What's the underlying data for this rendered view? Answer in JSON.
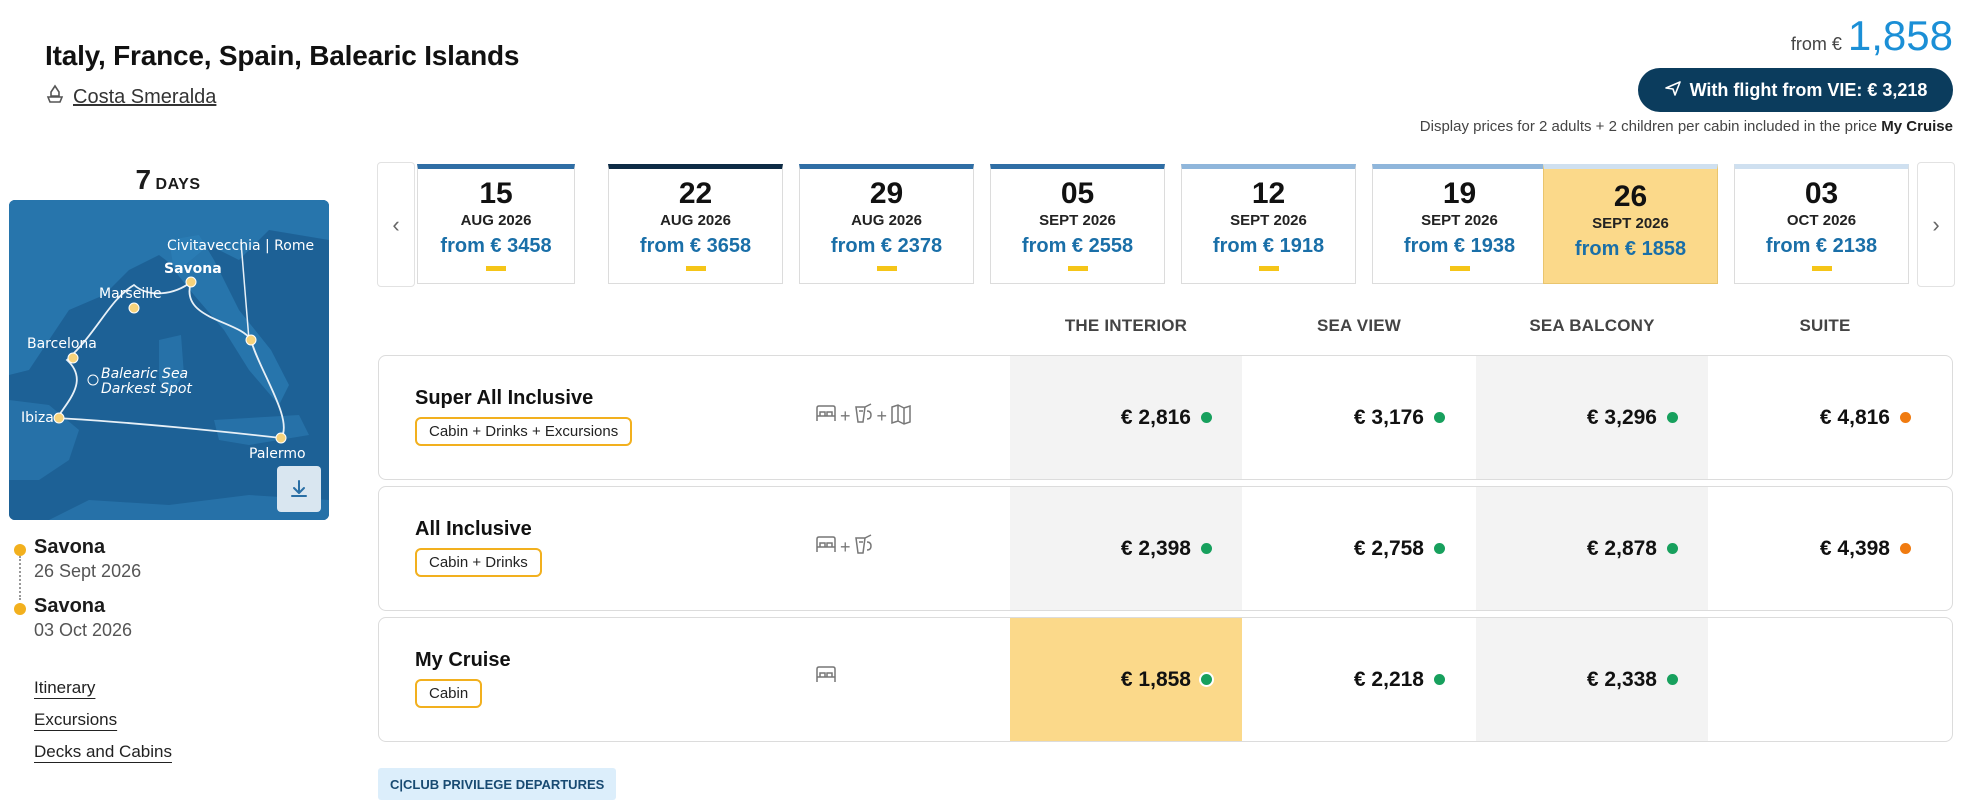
{
  "header": {
    "title": "Italy, France, Spain, Balearic Islands",
    "ship": "Costa Smeralda",
    "price_from_label": "from €",
    "price_from_value": "1,858",
    "flight_button": "With flight from VIE: € 3,218",
    "display_note": "Display prices for 2 adults + 2 children per cabin included in the price",
    "display_note_bold": "My Cruise"
  },
  "itinerary": {
    "days_number": "7",
    "days_label": "DAYS",
    "map_labels": {
      "civitavecchia": "Civitavecchia | Rome",
      "savona": "Savona",
      "marseille": "Marseille",
      "barcelona": "Barcelona",
      "balearic1": "Balearic Sea",
      "balearic2": "Darkest Spot",
      "ibiza": "Ibiza",
      "palermo": "Palermo"
    },
    "departure": {
      "port": "Savona",
      "date": "26 Sept 2026"
    },
    "arrival": {
      "port": "Savona",
      "date": "03 Oct 2026"
    }
  },
  "nav_links": [
    "Itinerary",
    "Excursions",
    "Decks and Cabins"
  ],
  "dates": [
    {
      "day": "15",
      "month": "AUG 2026",
      "price": "from € 3458",
      "top": "#2f6ea5"
    },
    {
      "day": "22",
      "month": "AUG 2026",
      "price": "from € 3658",
      "top": "#0d2b45"
    },
    {
      "day": "29",
      "month": "AUG 2026",
      "price": "from € 2378",
      "top": "#2f6ea5"
    },
    {
      "day": "05",
      "month": "SEPT 2026",
      "price": "from € 2558",
      "top": "#2f6ea5"
    },
    {
      "day": "12",
      "month": "SEPT 2026",
      "price": "from € 1918",
      "top": "#8fb6db"
    },
    {
      "day": "19",
      "month": "SEPT 2026",
      "price": "from € 1938",
      "top": "#8fb6db"
    },
    {
      "day": "26",
      "month": "SEPT 2026",
      "price": "from € 1858",
      "top": "#cfe0f0"
    },
    {
      "day": "03",
      "month": "OCT 2026",
      "price": "from € 2138",
      "top": "#cfe0f0"
    }
  ],
  "columns": [
    "THE INTERIOR",
    "SEA VIEW",
    "SEA BALCONY",
    "SUITE"
  ],
  "packages": [
    {
      "name": "Super All Inclusive",
      "tag": "Cabin + Drinks + Excursions",
      "prices": [
        "€ 2,816",
        "€ 3,176",
        "€ 3,296",
        "€ 4,816"
      ],
      "avail": [
        "g",
        "g",
        "g",
        "o"
      ]
    },
    {
      "name": "All Inclusive",
      "tag": "Cabin + Drinks",
      "prices": [
        "€ 2,398",
        "€ 2,758",
        "€ 2,878",
        "€ 4,398"
      ],
      "avail": [
        "g",
        "g",
        "g",
        "o"
      ]
    },
    {
      "name": "My Cruise",
      "tag": "Cabin",
      "prices": [
        "€ 1,858",
        "€ 2,218",
        "€ 2,338",
        ""
      ],
      "avail": [
        "g",
        "g",
        "g",
        ""
      ]
    }
  ],
  "plus": "+",
  "club_label": "C|CLUB PRIVILEGE DEPARTURES",
  "colors": {
    "accent": "#1b8fd6",
    "navy": "#0b3c5d",
    "highlight": "#fbd98a",
    "available": "#17a05d",
    "limited": "#f07b10"
  }
}
